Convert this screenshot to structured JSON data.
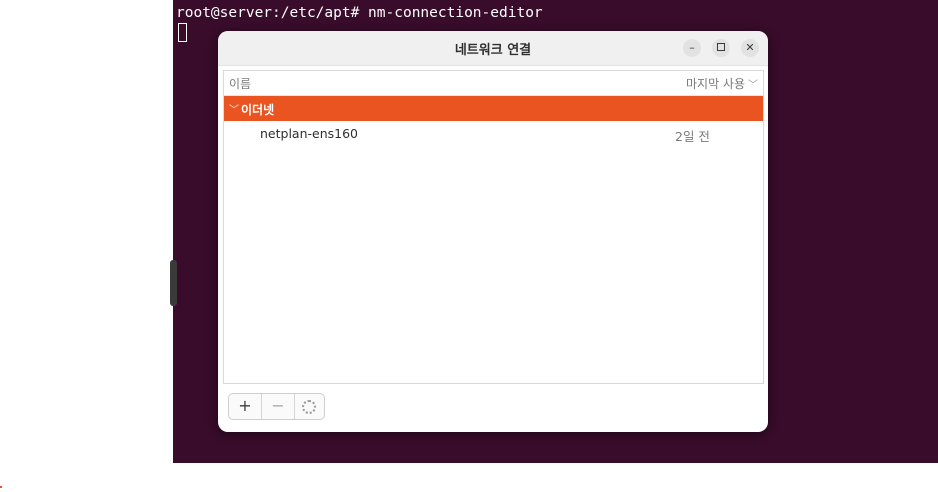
{
  "terminal": {
    "command_line": "root@server:/etc/apt# nm-connection-editor"
  },
  "dialog": {
    "title": "네트워크 연결",
    "controls": {
      "minimize": "–",
      "maximize": "□",
      "close": "✕"
    },
    "columns": {
      "name": "이름",
      "last_used": "마지막 사용"
    },
    "groups": [
      {
        "label": "이더넷",
        "connections": [
          {
            "name": "netplan-ens160",
            "last_used": "2일 전"
          }
        ]
      }
    ],
    "toolbar": {
      "add": "+",
      "remove": "−"
    }
  },
  "colors": {
    "terminal_bg": "#380c2a",
    "accent": "#e95420"
  }
}
